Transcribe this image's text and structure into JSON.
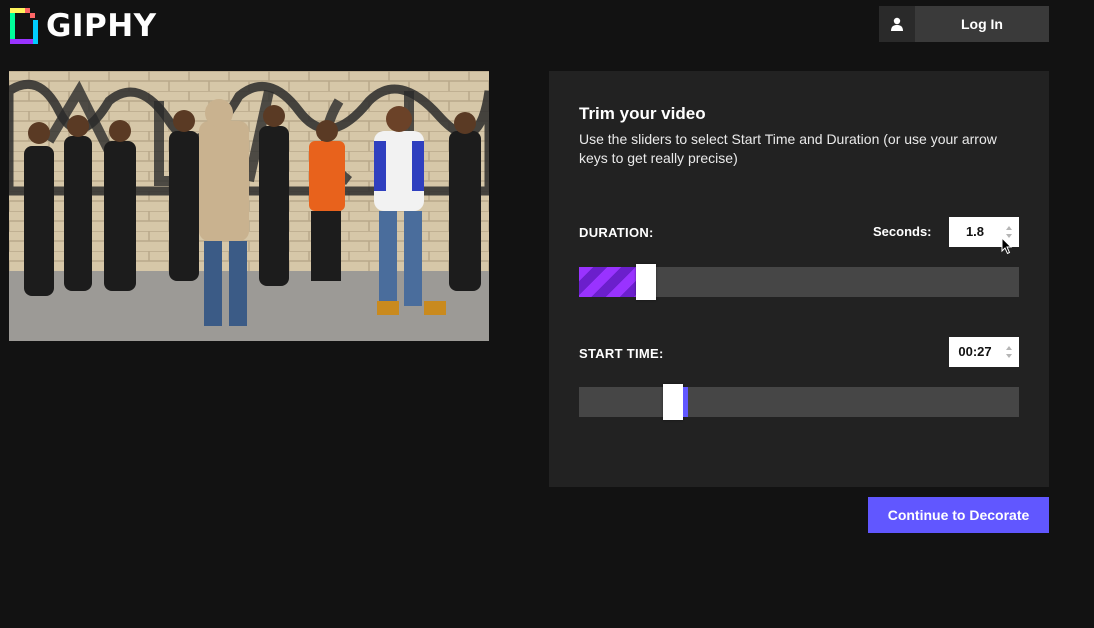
{
  "header": {
    "logo_text": "GIPHY",
    "login_label": "Log In",
    "login_icon": "user-icon"
  },
  "video": {
    "description_icon": "video-preview"
  },
  "trim": {
    "title": "Trim your video",
    "description": "Use the sliders to select Start Time and Duration (or use your arrow keys to get really precise)",
    "duration_label": "DURATION:",
    "seconds_label": "Seconds:",
    "duration_value": "1.8",
    "duration_slider_fraction": 0.13,
    "start_label": "START TIME:",
    "start_value": "00:27",
    "start_slider_fraction": 0.19
  },
  "footer": {
    "continue_label": "Continue to Decorate"
  },
  "colors": {
    "accent": "#6157ff",
    "purple": "#9933ff",
    "panel": "#222222",
    "background": "#121212"
  }
}
